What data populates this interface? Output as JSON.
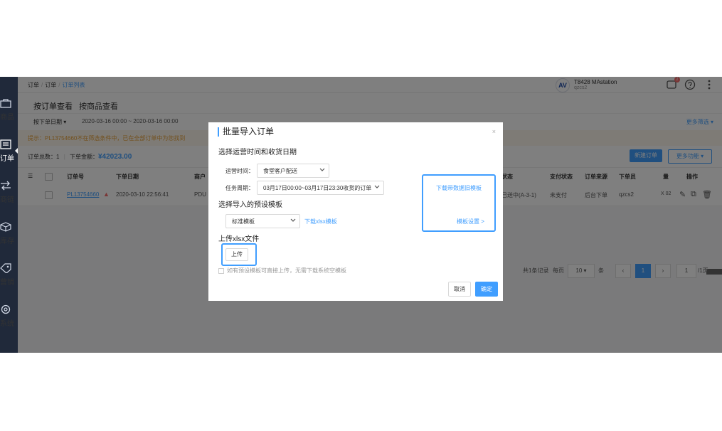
{
  "sidebar": {
    "items": [
      {
        "label": "商品",
        "icon": "bag-icon"
      },
      {
        "label": "订单",
        "icon": "list-icon",
        "active": true
      },
      {
        "label": "商链",
        "icon": "arrows-icon"
      },
      {
        "label": "库存",
        "icon": "box-icon"
      },
      {
        "label": "营销",
        "icon": "tag-icon"
      },
      {
        "label": "系统",
        "icon": "gear-icon"
      }
    ]
  },
  "topbar": {
    "breadcrumb": [
      "订单",
      "订单",
      "订单列表"
    ],
    "avatar_text": "AV",
    "user_name": "T8428 MAstation",
    "user_sub": "qzcs2",
    "notify_count": "1",
    "icons": [
      "bell-icon",
      "help-icon",
      "more-icon"
    ]
  },
  "tabs": [
    "按订单查看",
    "按商品查看"
  ],
  "filters": {
    "date_type": "按下单日期",
    "date_range": "2020-03-16 00:00 ~ 2020-03-16 00:00",
    "advanced": "更多筛选"
  },
  "alert_text": "提示：PL13754660不在筛选条件中，已在全部订单中为您找到",
  "summary": {
    "total_label": "订单总数：",
    "total": "1",
    "amount_label": "下单金额：",
    "amount": "¥42023.00",
    "new_button": "新建订单",
    "more_button": "更多功能"
  },
  "table": {
    "headers": [
      "订单号",
      "下单日期",
      "商户",
      "状态",
      "支付状态",
      "订单来源",
      "下单员",
      "量",
      "操作"
    ],
    "row": {
      "order_no": "PL13754660",
      "date": "2020-03-10 22:56:41",
      "merchant": "PDU",
      "status": "已送中(A-3-1)",
      "pay_status": "未支付",
      "source": "后台下单",
      "operator": "qzcs2",
      "qty": "X 02"
    }
  },
  "pager": {
    "total_text": "共1条记录",
    "per_page_label": "每页",
    "per_page": "10",
    "unit": "条",
    "current": "1",
    "jump": "1",
    "pages": "/1页"
  },
  "modal": {
    "title": "批量导入订单",
    "close": "×",
    "section1": "选择运营时间和收货日期",
    "operation_time_label": "运营时间：",
    "operation_time_value": "食堂客户配送",
    "task_period_label": "任务周期：",
    "task_period_value": "03月17日00:00~03月17日23:30收货的订单",
    "download_data_template": "下载带数据旧模板",
    "template_settings": "模板设置 >",
    "section2": "选择导入的预设模板",
    "preset_value": "标准模板",
    "download_xlsx": "下载xlsx模板",
    "section3": "上传xlsx文件",
    "upload_button": "上传",
    "hint": "如有预设模板可直接上传，无需下载系统空模板",
    "cancel_button": "取消",
    "confirm_button": "确定"
  },
  "colors": {
    "primary": "#409eff",
    "sidebar": "#20293a",
    "warning": "#e6a23c",
    "danger": "#f56c6c"
  }
}
